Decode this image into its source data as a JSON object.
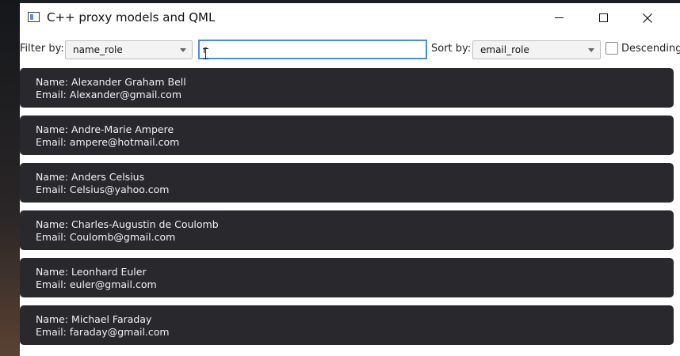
{
  "window": {
    "title": "C++ proxy models and QML"
  },
  "toolbar": {
    "filter_label": "Filter by:",
    "filter_value": "name_role",
    "search_value": "r",
    "sort_label": "Sort by:",
    "sort_value": "email_role",
    "descending_label": "Descending",
    "descending_checked": false
  },
  "list": {
    "items": [
      {
        "name": "Name: Alexander Graham Bell",
        "email": "Email: Alexander@gmail.com"
      },
      {
        "name": "Name: Andre-Marie Ampere",
        "email": "Email: ampere@hotmail.com"
      },
      {
        "name": "Name: Anders Celsius",
        "email": "Email: Celsius@yahoo.com"
      },
      {
        "name": "Name: Charles-Augustin de Coulomb",
        "email": "Email: Coulomb@gmail.com"
      },
      {
        "name": "Name: Leonhard Euler",
        "email": "Email: euler@gmail.com"
      },
      {
        "name": "Name: Michael Faraday",
        "email": "Email: faraday@gmail.com"
      }
    ]
  },
  "colors": {
    "card_bg": "#28282d",
    "focus_border": "#4a8fd4"
  }
}
